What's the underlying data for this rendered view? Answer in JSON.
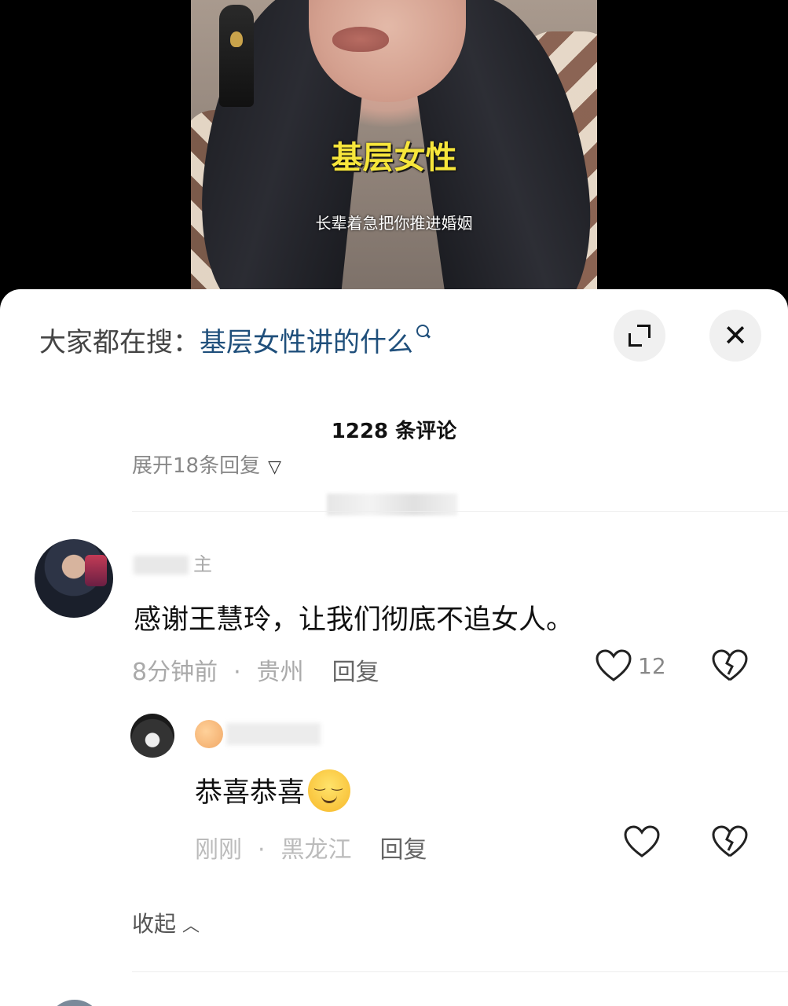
{
  "video": {
    "title": "基层女性",
    "subtitle": "长辈着急把你推进婚姻"
  },
  "search": {
    "label": "大家都在搜：",
    "query": "基层女性讲的什么"
  },
  "header": {
    "comment_count": "1228 条评论"
  },
  "expand_replies": {
    "label": "展开18条回复"
  },
  "comments": [
    {
      "username": "主",
      "text": "感谢王慧玲，让我们彻底不追女人。",
      "time": "8分钟前",
      "location": "贵州",
      "reply_label": "回复",
      "likes": "12"
    }
  ],
  "reply": {
    "text": "恭喜恭喜",
    "time": "刚刚",
    "location": "黑龙江",
    "reply_label": "回复"
  },
  "collapse": {
    "label": "收起"
  }
}
